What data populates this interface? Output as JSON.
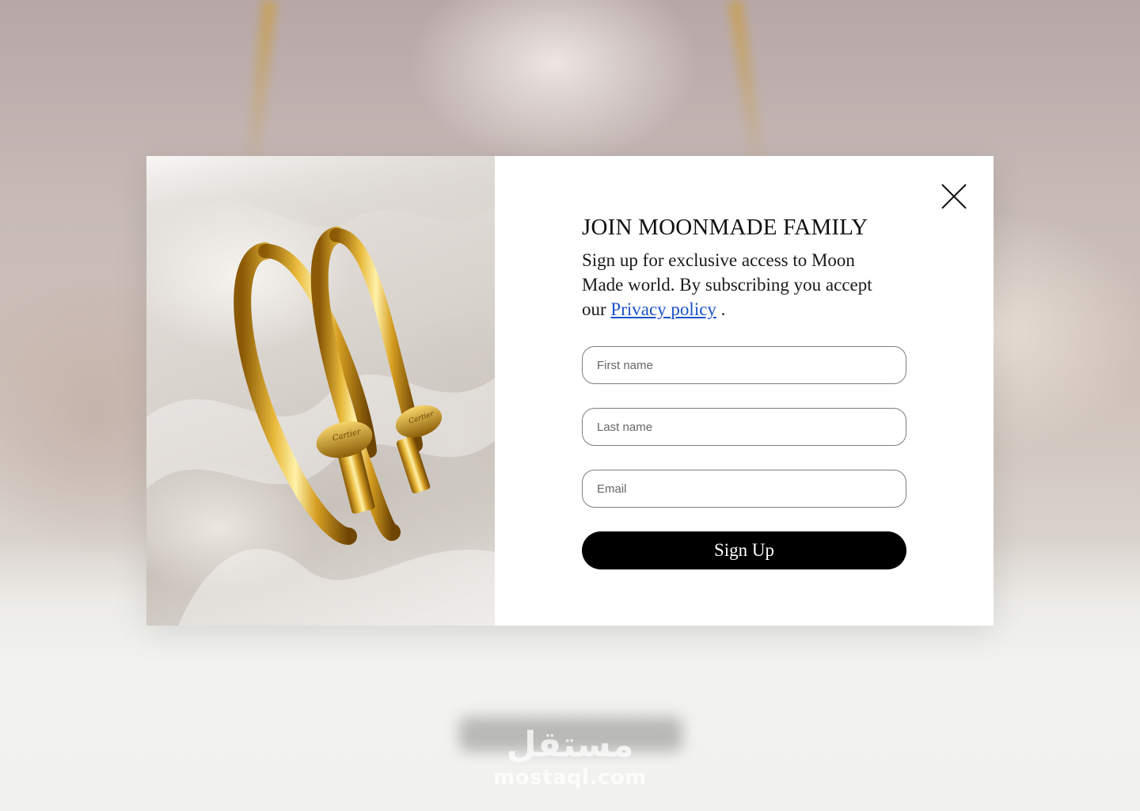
{
  "modal": {
    "title": "JOIN MOONMADE FAMILY",
    "description_prefix": "Sign up for exclusive access to Moon Made world. By subscribing you accept our",
    "privacy_link": "Privacy policy",
    "description_suffix": " .",
    "fields": {
      "first_name_placeholder": "First name",
      "last_name_placeholder": "Last name",
      "email_placeholder": "Email"
    },
    "submit_label": "Sign Up",
    "link_color": "#1a52c9",
    "button_color": "#000000"
  },
  "product_image": {
    "engraving": "Cartier"
  },
  "watermark": {
    "arabic": "مستقل",
    "latin": "mostaql.com"
  },
  "icons": {
    "close": "close-icon"
  }
}
